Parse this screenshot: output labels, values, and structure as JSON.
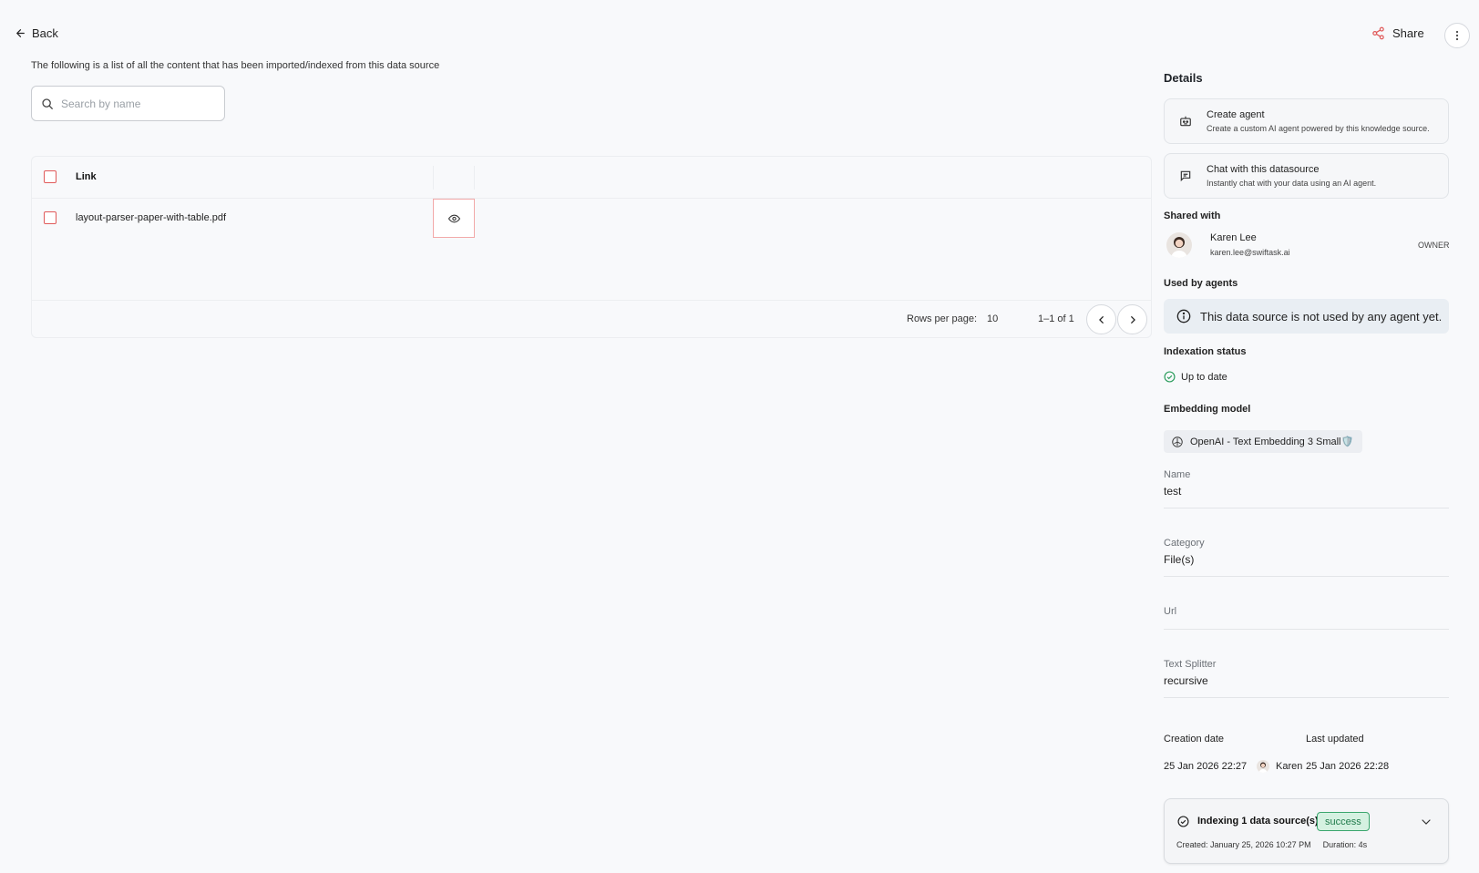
{
  "header": {
    "back_label": "Back",
    "share_label": "Share"
  },
  "intro_text": "The following is a list of all the content that has been imported/indexed from this data source",
  "search": {
    "placeholder": "Search by name",
    "value": ""
  },
  "table": {
    "columns": [
      "Link"
    ],
    "rows": [
      {
        "name": "layout-parser-paper-with-table.pdf"
      }
    ],
    "rows_per_page_label": "Rows per page:",
    "rows_per_page": "10",
    "range": "1–1 of 1"
  },
  "details": {
    "title": "Details",
    "actions": [
      {
        "title": "Create agent",
        "subtitle": "Create a custom AI agent powered by this knowledge source."
      },
      {
        "title": "Chat with this datasource",
        "subtitle": "Instantly chat with your data using an AI agent."
      }
    ],
    "shared_with": {
      "title": "Shared with",
      "user_name": "Karen Lee",
      "user_email": "karen.lee@swiftask.ai",
      "role": "OWNER"
    },
    "used_by_agents": {
      "title": "Used by agents",
      "message": "This data source is not used by any agent yet."
    },
    "indexation_status": {
      "title": "Indexation status",
      "value": "Up to date"
    },
    "embedding_model": {
      "title": "Embedding model",
      "value": "OpenAI - Text Embedding 3 Small🛡️"
    },
    "fields": [
      {
        "label": "Name",
        "value": "test"
      },
      {
        "label": "Category",
        "value": "File(s)"
      },
      {
        "label": "Url",
        "value": ""
      },
      {
        "label": "Text Splitter",
        "value": "recursive"
      }
    ],
    "creation": {
      "label": "Creation date",
      "date": "25 Jan 2026 22:27",
      "user": "Karen"
    },
    "updated": {
      "label": "Last updated",
      "date": "25 Jan 2026 22:28"
    },
    "indexing_job": {
      "title": "Indexing 1 data source(s)",
      "status": "success",
      "created": "Created: January 25, 2026 10:27 PM",
      "duration": "Duration: 4s"
    }
  },
  "colors": {
    "accent_red": "#e05a5a",
    "success_green": "#3aa66d",
    "background": "#f8f9fb"
  }
}
